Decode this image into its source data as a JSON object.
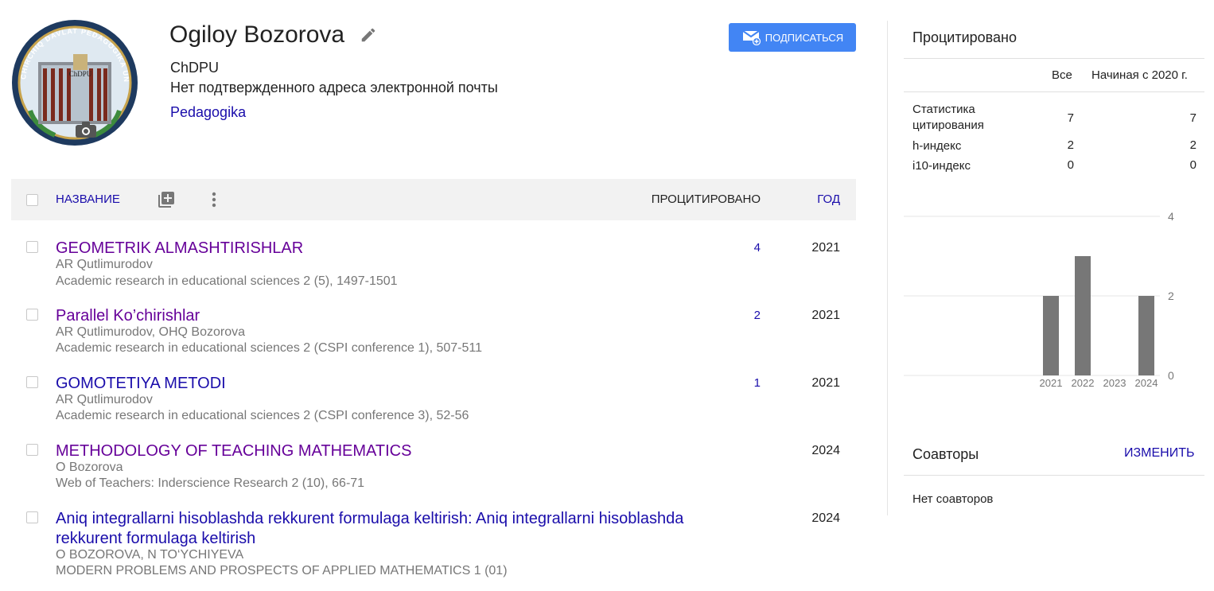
{
  "profile": {
    "name": "Ogiloy Bozorova",
    "affiliation": "ChDPU",
    "email_status": "Нет подтвержденного адреса электронной почты",
    "interest": "Pedagogika",
    "follow_label": "ПОДПИСАТЬСЯ",
    "logo_text_top": "CHIRCHIQ DAVLAT PEDAGOGIKA UNIVERSITETI",
    "logo_building": "ChDPU"
  },
  "table": {
    "col_title": "НАЗВАНИЕ",
    "col_cited": "ПРОЦИТИРОВАНО",
    "col_year": "ГОД",
    "rows": [
      {
        "title": "GEOMETRIK ALMASHTIRISHLAR",
        "authors": "AR Qutlimurodov",
        "venue": "Academic research in educational sciences 2 (5), 1497-1501",
        "cites": "4",
        "year": "2021",
        "visited": true
      },
      {
        "title": "Parallel Ko’chirishlar",
        "authors": "AR Qutlimurodov, OHQ Bozorova",
        "venue": "Academic research in educational sciences 2 (CSPI conference 1), 507-511",
        "cites": "2",
        "year": "2021",
        "visited": true
      },
      {
        "title": "GOMOTETIYA METODI",
        "authors": "AR Qutlimurodov",
        "venue": "Academic research in educational sciences 2 (CSPI conference 3), 52-56",
        "cites": "1",
        "year": "2021",
        "visited": false
      },
      {
        "title": "METHODOLOGY OF TEACHING MATHEMATICS",
        "authors": "O Bozorova",
        "venue": "Web of Teachers: Inderscience Research 2 (10), 66-71",
        "cites": "",
        "year": "2024",
        "visited": true
      },
      {
        "title": "Aniq integrallarni hisoblashda rekkurent formulaga keltirish: Aniq integrallarni hisoblashda rekkurent formulaga keltirish",
        "authors": "O BOZOROVA, N TO‘YCHIYEVA",
        "venue": "MODERN PROBLEMS AND PROSPECTS OF APPLIED MATHEMATICS 1 (01)",
        "cites": "",
        "year": "2024",
        "visited": false
      }
    ]
  },
  "citations": {
    "title": "Процитировано",
    "col_all": "Все",
    "col_since": "Начиная с 2020 г.",
    "rows": [
      {
        "label": "Статистика цитирования",
        "all": "7",
        "since": "7"
      },
      {
        "label": "h-индекс",
        "all": "2",
        "since": "2"
      },
      {
        "label": "i10-индекс",
        "all": "0",
        "since": "0"
      }
    ]
  },
  "chart_data": {
    "type": "bar",
    "categories": [
      "2021",
      "2022",
      "2023",
      "2024"
    ],
    "values": [
      2,
      3,
      0,
      2
    ],
    "yticks": [
      "4",
      "2",
      "0"
    ],
    "ylim": [
      0,
      4
    ],
    "bar_color": "#777777",
    "grid": true
  },
  "coauthors": {
    "title": "Соавторы",
    "edit_label": "ИЗМЕНИТЬ",
    "empty_text": "Нет соавторов"
  },
  "icons": {
    "edit": "pencil-icon",
    "follow": "envelope-plus-icon",
    "add": "add-to-library-icon",
    "more": "more-vert-icon",
    "camera": "camera-icon"
  },
  "colors": {
    "link": "#1a0dab",
    "visited": "#660099",
    "button": "#4285f4"
  }
}
